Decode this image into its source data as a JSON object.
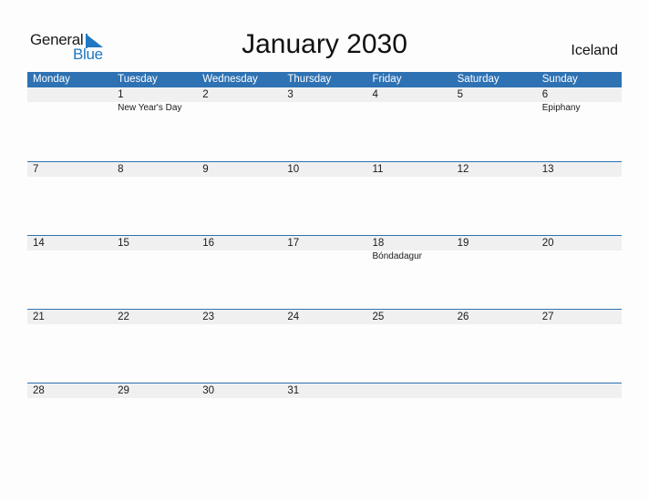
{
  "logo": {
    "word1": "General",
    "word2": "Blue"
  },
  "title": "January 2030",
  "country": "Iceland",
  "colors": {
    "header_bg": "#2e72b3",
    "band_bg": "#f0f0f0",
    "brand_blue": "#1f78c1"
  },
  "weekdays": [
    "Monday",
    "Tuesday",
    "Wednesday",
    "Thursday",
    "Friday",
    "Saturday",
    "Sunday"
  ],
  "weeks": [
    {
      "days": [
        "",
        "1",
        "2",
        "3",
        "4",
        "5",
        "6"
      ],
      "events": [
        "",
        "New Year's Day",
        "",
        "",
        "",
        "",
        "Epiphany"
      ]
    },
    {
      "days": [
        "7",
        "8",
        "9",
        "10",
        "11",
        "12",
        "13"
      ],
      "events": [
        "",
        "",
        "",
        "",
        "",
        "",
        ""
      ]
    },
    {
      "days": [
        "14",
        "15",
        "16",
        "17",
        "18",
        "19",
        "20"
      ],
      "events": [
        "",
        "",
        "",
        "",
        "Bóndadagur",
        "",
        ""
      ]
    },
    {
      "days": [
        "21",
        "22",
        "23",
        "24",
        "25",
        "26",
        "27"
      ],
      "events": [
        "",
        "",
        "",
        "",
        "",
        "",
        ""
      ]
    },
    {
      "days": [
        "28",
        "29",
        "30",
        "31",
        "",
        "",
        ""
      ],
      "events": [
        "",
        "",
        "",
        "",
        "",
        "",
        ""
      ]
    }
  ]
}
